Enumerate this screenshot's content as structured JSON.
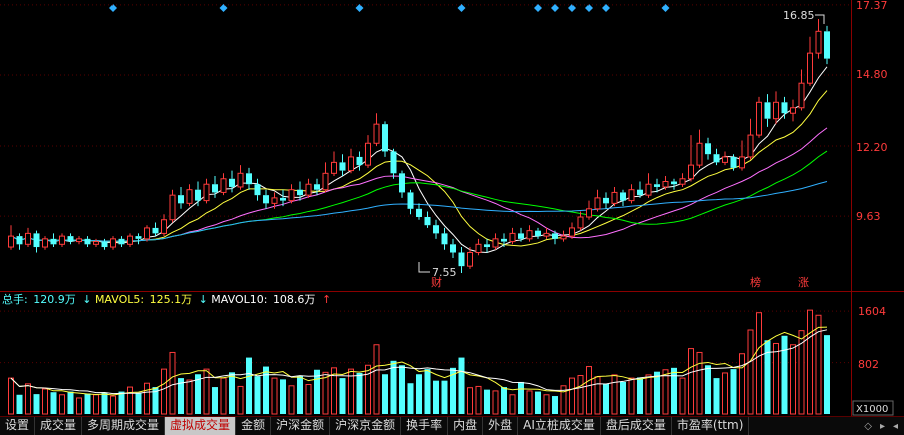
{
  "colors": {
    "up": "#ff3b3b",
    "down": "#54ffff",
    "ma5": "#ffffff",
    "ma10": "#ffff40",
    "ma20": "#ff70ff",
    "ma30": "#00ff00",
    "ma60": "#30b0ff",
    "axis_red": "#8b0000"
  },
  "price_axis": {
    "labels": [
      "17.37",
      "14.80",
      "12.20",
      "9.63"
    ]
  },
  "volume_axis": {
    "labels": [
      "1604",
      "802"
    ],
    "unit": "X1000"
  },
  "annotations": {
    "high": "16.85",
    "low": "7.55",
    "marker_cai": "财",
    "marker_bang": "榜",
    "marker_zhang": "涨"
  },
  "volume_legend": {
    "total_label": "总手:",
    "total_value": "120.9万",
    "mavol5_label": "MAVOL5:",
    "mavol5_value": "125.1万",
    "mavol10_label": "MAVOL10:",
    "mavol10_value": "108.6万"
  },
  "tabs": [
    "设置",
    "成交量",
    "多周期成交量",
    "虚拟成交量",
    "金额",
    "沪深金额",
    "沪深京金额",
    "换手率",
    "内盘",
    "外盘",
    "AI立桩成交量",
    "盘后成交量",
    "市盈率(ttm)"
  ],
  "active_tab": "虚拟成交量",
  "chart_data": {
    "type": "candlestick",
    "y_range": [
      7.0,
      17.4
    ],
    "volume_range": [
      0,
      1700
    ],
    "candles": [
      [
        8.5,
        8.9,
        9.3,
        8.4
      ],
      [
        8.9,
        8.6,
        9.0,
        8.4
      ],
      [
        8.6,
        9.0,
        9.2,
        8.5
      ],
      [
        9.0,
        8.5,
        9.1,
        8.3
      ],
      [
        8.5,
        8.8,
        8.9,
        8.4
      ],
      [
        8.8,
        8.6,
        9.0,
        8.5
      ],
      [
        8.6,
        8.9,
        9.0,
        8.5
      ],
      [
        8.9,
        8.7,
        9.0,
        8.6
      ],
      [
        8.7,
        8.8,
        8.9,
        8.6
      ],
      [
        8.8,
        8.6,
        8.9,
        8.5
      ],
      [
        8.6,
        8.7,
        8.8,
        8.5
      ],
      [
        8.7,
        8.5,
        8.8,
        8.4
      ],
      [
        8.5,
        8.8,
        8.9,
        8.4
      ],
      [
        8.8,
        8.6,
        8.9,
        8.5
      ],
      [
        8.6,
        8.9,
        9.0,
        8.5
      ],
      [
        8.9,
        8.8,
        9.0,
        8.6
      ],
      [
        8.8,
        9.2,
        9.3,
        8.7
      ],
      [
        9.2,
        9.0,
        9.4,
        8.9
      ],
      [
        9.0,
        9.5,
        9.7,
        8.9
      ],
      [
        9.5,
        10.4,
        10.6,
        9.4
      ],
      [
        10.4,
        10.1,
        10.7,
        9.9
      ],
      [
        10.1,
        10.6,
        10.8,
        10.0
      ],
      [
        10.6,
        10.2,
        10.9,
        10.0
      ],
      [
        10.2,
        10.8,
        11.0,
        10.1
      ],
      [
        10.8,
        10.5,
        11.1,
        10.3
      ],
      [
        10.5,
        11.0,
        11.2,
        10.4
      ],
      [
        11.0,
        10.7,
        11.3,
        10.5
      ],
      [
        10.7,
        11.2,
        11.5,
        10.6
      ],
      [
        11.2,
        10.8,
        11.4,
        10.6
      ],
      [
        10.8,
        10.4,
        11.0,
        10.2
      ],
      [
        10.4,
        10.1,
        10.6,
        9.9
      ],
      [
        10.1,
        10.3,
        10.5,
        9.9
      ],
      [
        10.3,
        10.2,
        10.6,
        10.0
      ],
      [
        10.2,
        10.6,
        10.8,
        10.1
      ],
      [
        10.6,
        10.4,
        10.9,
        10.2
      ],
      [
        10.4,
        10.8,
        11.0,
        10.3
      ],
      [
        10.8,
        10.6,
        11.0,
        10.4
      ],
      [
        10.6,
        11.2,
        11.6,
        10.5
      ],
      [
        11.2,
        11.6,
        12.0,
        11.1
      ],
      [
        11.6,
        11.3,
        11.9,
        11.1
      ],
      [
        11.3,
        11.8,
        12.1,
        11.2
      ],
      [
        11.8,
        11.5,
        12.0,
        11.3
      ],
      [
        11.5,
        12.3,
        12.6,
        11.4
      ],
      [
        12.3,
        13.0,
        13.4,
        12.2
      ],
      [
        13.0,
        12.0,
        13.1,
        11.8
      ],
      [
        12.0,
        11.2,
        12.1,
        11.0
      ],
      [
        11.2,
        10.5,
        11.3,
        10.3
      ],
      [
        10.5,
        9.9,
        10.6,
        9.7
      ],
      [
        9.9,
        9.6,
        10.1,
        9.5
      ],
      [
        9.6,
        9.3,
        9.8,
        9.2
      ],
      [
        9.3,
        9.0,
        9.5,
        8.8
      ],
      [
        9.0,
        8.6,
        9.2,
        8.4
      ],
      [
        8.6,
        8.3,
        8.8,
        8.1
      ],
      [
        8.3,
        7.8,
        8.5,
        7.55
      ],
      [
        7.8,
        8.3,
        8.5,
        7.7
      ],
      [
        8.3,
        8.6,
        8.8,
        8.2
      ],
      [
        8.6,
        8.5,
        8.8,
        8.3
      ],
      [
        8.5,
        8.8,
        9.0,
        8.4
      ],
      [
        8.8,
        8.7,
        9.0,
        8.5
      ],
      [
        8.7,
        9.0,
        9.2,
        8.6
      ],
      [
        9.0,
        8.8,
        9.2,
        8.7
      ],
      [
        8.8,
        9.1,
        9.3,
        8.7
      ],
      [
        9.1,
        8.9,
        9.2,
        8.8
      ],
      [
        8.9,
        9.0,
        9.2,
        8.8
      ],
      [
        9.0,
        8.8,
        9.1,
        8.6
      ],
      [
        8.8,
        8.9,
        9.1,
        8.7
      ],
      [
        8.9,
        9.2,
        9.4,
        8.8
      ],
      [
        9.2,
        9.6,
        9.8,
        9.1
      ],
      [
        9.6,
        9.9,
        10.2,
        9.5
      ],
      [
        9.9,
        10.3,
        10.6,
        9.8
      ],
      [
        10.3,
        10.1,
        10.5,
        9.9
      ],
      [
        10.1,
        10.5,
        10.7,
        10.0
      ],
      [
        10.5,
        10.2,
        10.6,
        10.0
      ],
      [
        10.2,
        10.6,
        10.8,
        10.1
      ],
      [
        10.6,
        10.4,
        10.9,
        10.3
      ],
      [
        10.4,
        10.8,
        11.2,
        10.3
      ],
      [
        10.8,
        10.7,
        11.0,
        10.5
      ],
      [
        10.7,
        10.9,
        11.1,
        10.6
      ],
      [
        10.9,
        10.8,
        11.0,
        10.6
      ],
      [
        10.8,
        11.0,
        11.2,
        10.7
      ],
      [
        11.0,
        11.5,
        12.6,
        10.9
      ],
      [
        11.5,
        12.3,
        12.8,
        11.4
      ],
      [
        12.3,
        11.9,
        12.5,
        11.7
      ],
      [
        11.9,
        11.6,
        12.1,
        11.5
      ],
      [
        11.6,
        11.8,
        12.0,
        11.5
      ],
      [
        11.8,
        11.4,
        11.9,
        11.3
      ],
      [
        11.4,
        11.8,
        12.4,
        11.3
      ],
      [
        11.8,
        12.6,
        13.2,
        11.7
      ],
      [
        12.6,
        13.8,
        14.0,
        12.5
      ],
      [
        13.8,
        13.2,
        14.1,
        12.9
      ],
      [
        13.2,
        13.8,
        14.2,
        13.0
      ],
      [
        13.8,
        13.4,
        14.0,
        13.2
      ],
      [
        13.4,
        13.6,
        13.9,
        13.1
      ],
      [
        13.6,
        14.5,
        15.0,
        13.5
      ],
      [
        14.5,
        15.6,
        16.2,
        14.4
      ],
      [
        15.6,
        16.4,
        16.85,
        15.4
      ],
      [
        16.4,
        15.4,
        16.6,
        15.2
      ]
    ],
    "volume": [
      560,
      300,
      470,
      310,
      390,
      340,
      300,
      350,
      250,
      320,
      300,
      330,
      280,
      350,
      420,
      330,
      480,
      420,
      700,
      960,
      560,
      530,
      620,
      700,
      420,
      560,
      650,
      430,
      880,
      590,
      740,
      560,
      540,
      440,
      600,
      460,
      690,
      650,
      720,
      560,
      700,
      640,
      760,
      1080,
      620,
      830,
      760,
      480,
      620,
      700,
      520,
      520,
      720,
      880,
      410,
      430,
      380,
      360,
      420,
      300,
      500,
      360,
      350,
      300,
      280,
      440,
      560,
      600,
      740,
      580,
      470,
      610,
      500,
      560,
      570,
      610,
      660,
      690,
      720,
      560,
      1020,
      960,
      760,
      560,
      640,
      700,
      940,
      1310,
      1580,
      1150,
      1100,
      1220,
      1080,
      1300,
      1620,
      1540,
      1230
    ],
    "ma": {
      "ma5": "white",
      "ma10": "yellow",
      "ma20": "magenta",
      "ma30": "green",
      "ma60": "blue"
    }
  }
}
